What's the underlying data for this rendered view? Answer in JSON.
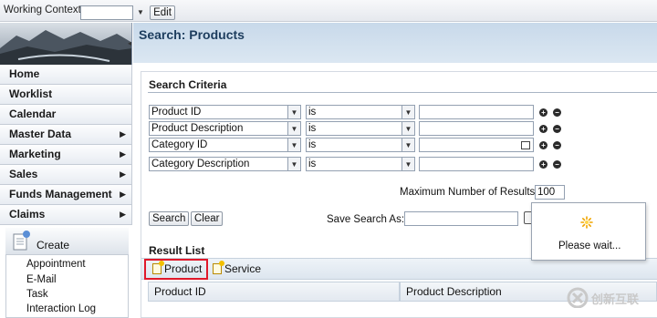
{
  "topbar": {
    "context_label": "Working Context:",
    "context_value": "",
    "edit_label": "Edit"
  },
  "nav": {
    "items": [
      {
        "label": "Home",
        "has_submenu": false
      },
      {
        "label": "Worklist",
        "has_submenu": false
      },
      {
        "label": "Calendar",
        "has_submenu": false
      },
      {
        "label": "Master Data",
        "has_submenu": true
      },
      {
        "label": "Marketing",
        "has_submenu": true
      },
      {
        "label": "Sales",
        "has_submenu": true
      },
      {
        "label": "Funds Management",
        "has_submenu": true
      },
      {
        "label": "Claims",
        "has_submenu": true
      }
    ],
    "create": {
      "label": "Create",
      "links": [
        "Appointment",
        "E-Mail",
        "Task",
        "Interaction Log"
      ]
    }
  },
  "page": {
    "title": "Search: Products"
  },
  "search": {
    "section_title": "Search Criteria",
    "rows": [
      {
        "field": "Product ID",
        "operator": "is",
        "value": ""
      },
      {
        "field": "Product Description",
        "operator": "is",
        "value": ""
      },
      {
        "field": "Category ID",
        "operator": "is",
        "value": ""
      },
      {
        "field": "Category Description",
        "operator": "is",
        "value": ""
      }
    ],
    "max_results_label": "Maximum Number of Results:",
    "max_results_value": "100",
    "search_button": "Search",
    "clear_button": "Clear",
    "save_search_label": "Save Search As:",
    "save_search_value": ""
  },
  "results": {
    "section_title": "Result List",
    "toolbar": {
      "product_button": "Product",
      "service_button": "Service"
    },
    "columns": [
      "Product ID",
      "Product Description"
    ]
  },
  "popup": {
    "text": "Please wait..."
  },
  "watermark": {
    "text": "创新互联"
  },
  "colors": {
    "title_band": "#d0e0ef",
    "title_text": "#1d3d5e",
    "highlight": "#e0182a"
  }
}
